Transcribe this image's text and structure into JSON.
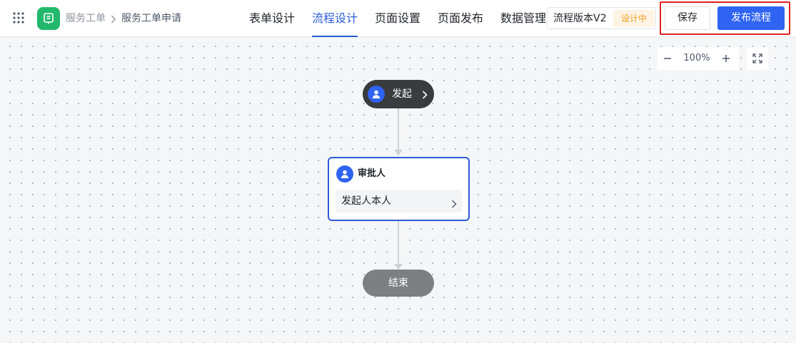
{
  "breadcrumb": {
    "app": "服务工单",
    "page": "服务工单申请"
  },
  "tabs": [
    {
      "label": "表单设计"
    },
    {
      "label": "流程设计",
      "active": true
    },
    {
      "label": "页面设置"
    },
    {
      "label": "页面发布"
    },
    {
      "label": "数据管理"
    }
  ],
  "version": {
    "label": "流程版本V2",
    "status": "设计中"
  },
  "actions": {
    "save": "保存",
    "publish": "发布流程"
  },
  "zoom": {
    "value": "100%"
  },
  "flow": {
    "start_label": "发起",
    "approver_title": "审批人",
    "approver_value": "发起人本人",
    "end_label": "结束"
  },
  "colors": {
    "accent": "#2f63f1",
    "active_tab": "#2b5bd7",
    "logo": "#21b86c",
    "status_text": "#f0a020",
    "highlight": "#e02020"
  },
  "icons": {
    "apps": "apps-grid-icon",
    "logo": "form-icon",
    "breadcrumb_sep": "chevron-right-icon",
    "zoom_out": "minus-icon",
    "zoom_in": "plus-icon",
    "fullscreen": "fullscreen-icon",
    "user": "user-icon"
  }
}
